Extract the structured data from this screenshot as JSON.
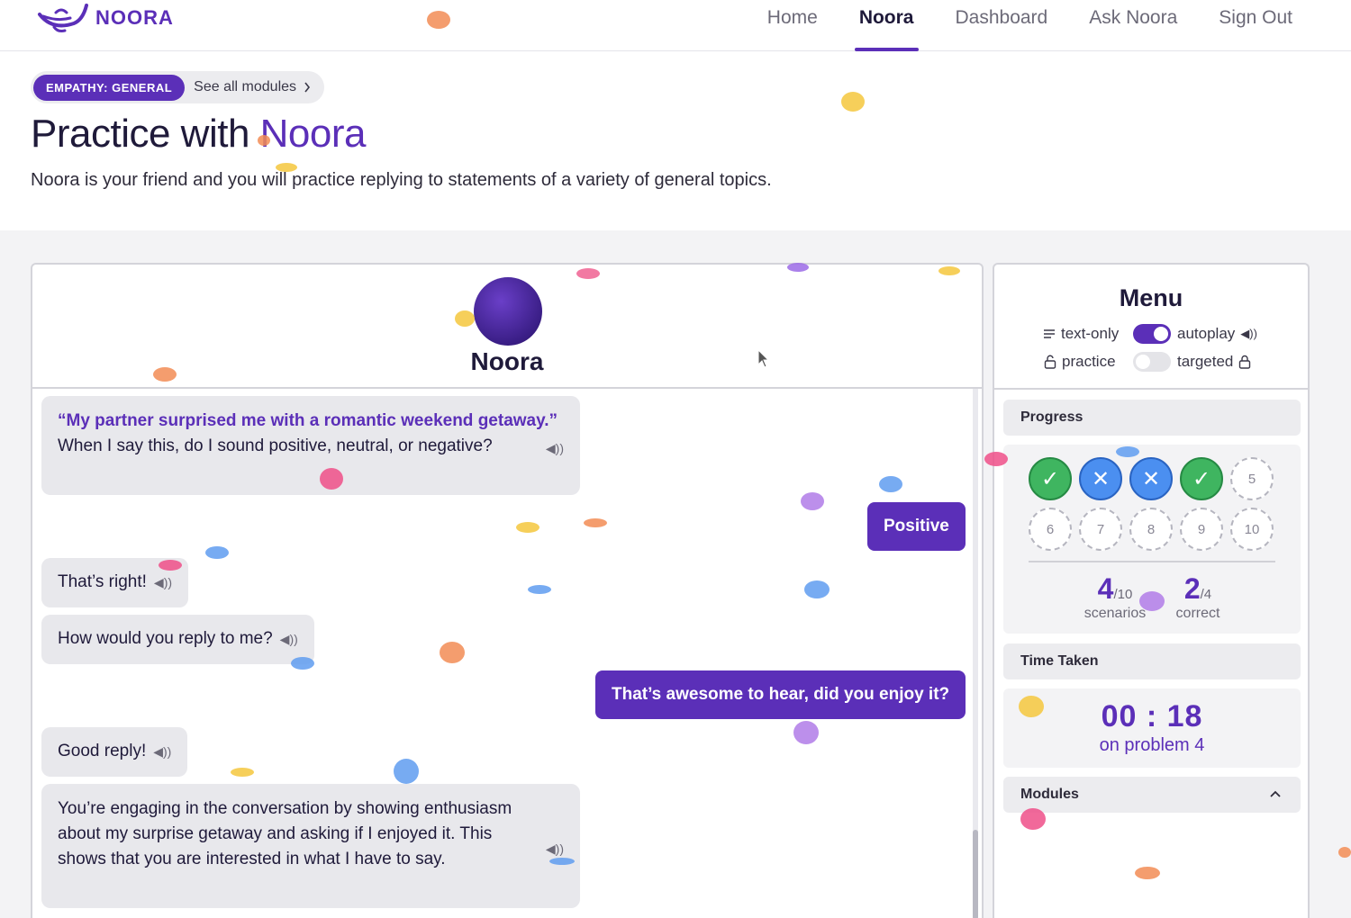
{
  "nav": {
    "brand": "NOORA",
    "links": [
      {
        "label": "Home",
        "active": false
      },
      {
        "label": "Noora",
        "active": true
      },
      {
        "label": "Dashboard",
        "active": false
      },
      {
        "label": "Ask Noora",
        "active": false
      },
      {
        "label": "Sign Out",
        "active": false
      }
    ]
  },
  "header": {
    "module_tag": "EMPATHY: GENERAL",
    "see_all": "See all modules",
    "title_prefix": "Practice with",
    "title_accent": "Noora",
    "description": "Noora is your friend and you will practice replying to statements of a variety of general topics."
  },
  "chat": {
    "bot_name": "Noora",
    "messages": [
      {
        "from": "bot",
        "quote": "“My partner surprised me with a romantic weekend getaway.”",
        "text": " When I say this, do I sound positive, neutral, or negative?"
      },
      {
        "from": "user",
        "text": "Positive"
      },
      {
        "from": "bot",
        "text": "That’s right!"
      },
      {
        "from": "bot",
        "text": "How would you reply to me?"
      },
      {
        "from": "user",
        "text": "That’s awesome to hear, did you enjoy it?"
      },
      {
        "from": "bot",
        "text": "Good reply!"
      },
      {
        "from": "bot",
        "text": "You’re engaging in the conversation by showing enthusiasm about my surprise getaway and asking if I enjoyed it. This shows that you are interested in what I have to say."
      }
    ]
  },
  "menu": {
    "title": "Menu",
    "text_only": "text-only",
    "autoplay": "autoplay",
    "autoplay_on": true,
    "practice": "practice",
    "targeted": "targeted",
    "targeted_on": false,
    "progress": {
      "label": "Progress",
      "items": [
        {
          "n": "1",
          "status": "correct",
          "glyph": "✓"
        },
        {
          "n": "2",
          "status": "incorrect",
          "glyph": "✕"
        },
        {
          "n": "3",
          "status": "incorrect",
          "glyph": "✕"
        },
        {
          "n": "4",
          "status": "correct",
          "glyph": "✓"
        },
        {
          "n": "5",
          "status": "pending",
          "glyph": "5"
        },
        {
          "n": "6",
          "status": "pending",
          "glyph": "6"
        },
        {
          "n": "7",
          "status": "pending",
          "glyph": "7"
        },
        {
          "n": "8",
          "status": "pending",
          "glyph": "8"
        },
        {
          "n": "9",
          "status": "pending",
          "glyph": "9"
        },
        {
          "n": "10",
          "status": "pending",
          "glyph": "10"
        }
      ],
      "scenarios_value": "4",
      "scenarios_total": "/10",
      "scenarios_label": "scenarios",
      "correct_value": "2",
      "correct_total": "/4",
      "correct_label": "correct"
    },
    "time": {
      "label": "Time Taken",
      "value": "00 : 18",
      "sub": "on problem 4"
    },
    "modules": {
      "label": "Modules"
    }
  },
  "colors": {
    "brand": "#5b2fb8",
    "correct": "#3fb560",
    "incorrect": "#4b8ff0"
  }
}
